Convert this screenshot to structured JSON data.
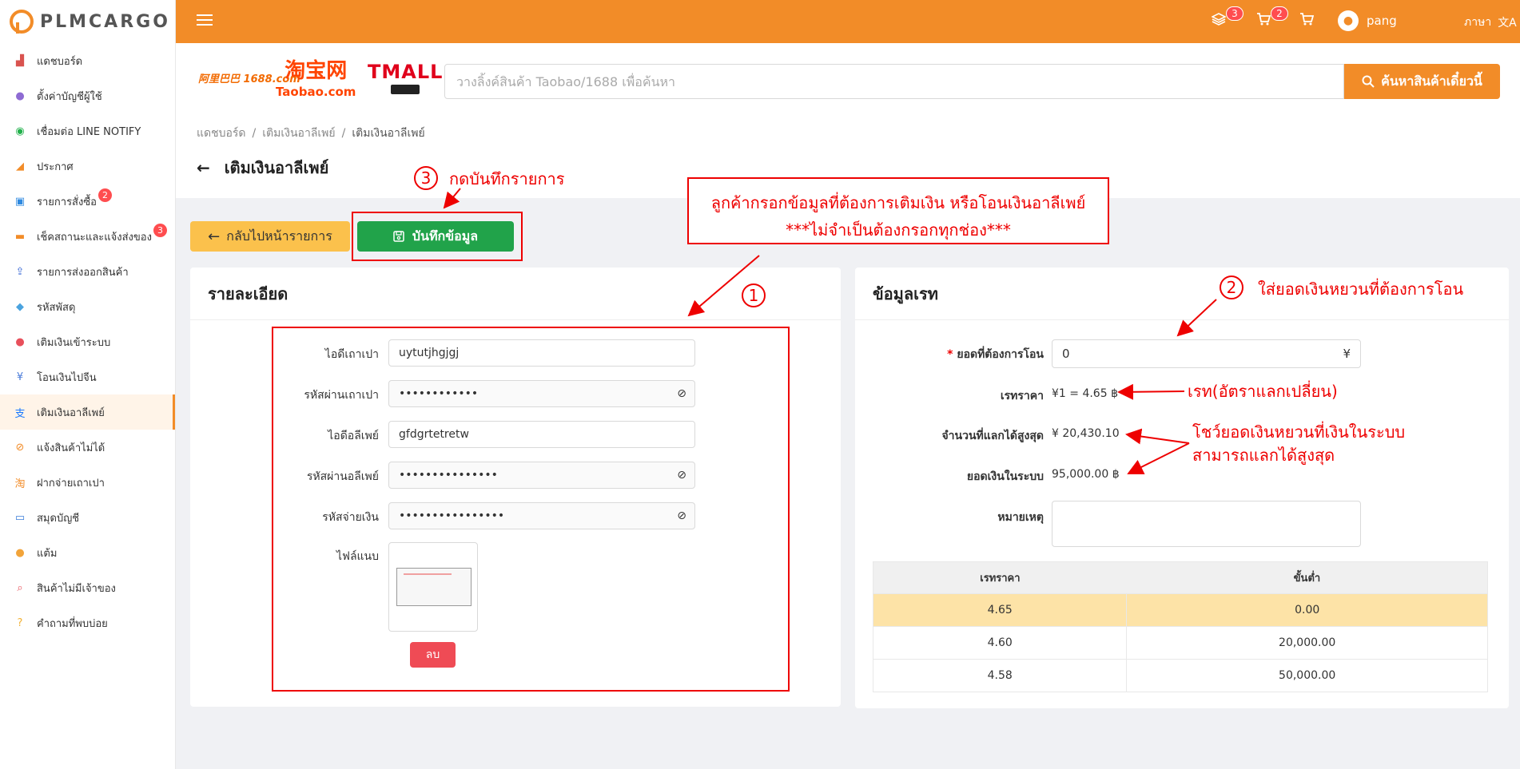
{
  "app": {
    "logo_text": "PLMCARGO"
  },
  "sidebar": {
    "items": [
      {
        "label": "แดชบอร์ด",
        "icon": "chart-icon"
      },
      {
        "label": "ตั้งค่าบัญชีผู้ใช้",
        "icon": "user-settings-icon"
      },
      {
        "label": "เชื่อมต่อ LINE NOTIFY",
        "icon": "line-icon"
      },
      {
        "label": "ประกาศ",
        "icon": "megaphone-icon"
      },
      {
        "label": "รายการสั่งซื้อ",
        "icon": "cart-icon",
        "badge": "2"
      },
      {
        "label": "เช็คสถานะและแจ้งส่งของ",
        "icon": "truck-icon",
        "badge": "3"
      },
      {
        "label": "รายการส่งออกสินค้า",
        "icon": "export-icon"
      },
      {
        "label": "รหัสพัสดุ",
        "icon": "box-icon"
      },
      {
        "label": "เติมเงินเข้าระบบ",
        "icon": "piggy-bank-icon"
      },
      {
        "label": "โอนเงินไปจีน",
        "icon": "yuan-icon"
      },
      {
        "label": "เติมเงินอาลีเพย์",
        "icon": "alipay-icon",
        "active": true
      },
      {
        "label": "แจ้งสินค้าไม่ได้",
        "icon": "no-item-icon"
      },
      {
        "label": "ฝากจ่ายเถาเปา",
        "icon": "taobao-pay-icon"
      },
      {
        "label": "สมุดบัญชี",
        "icon": "wallet-icon"
      },
      {
        "label": "แต้ม",
        "icon": "coin-icon"
      },
      {
        "label": "สินค้าไม่มีเจ้าของ",
        "icon": "search-box-icon"
      },
      {
        "label": "คำถามที่พบบ่อย",
        "icon": "question-icon"
      }
    ]
  },
  "topbar": {
    "badge_layers": "3",
    "badge_cart": "2",
    "username": "pang",
    "language": "ภาษา"
  },
  "search": {
    "brand_1688": "阿里巴巴 1688.com",
    "brand_taobao": "淘宝网",
    "brand_taobao_sub": "Taobao.com",
    "brand_tmall": "TMALL",
    "placeholder": "วางลิ้งค์สินค้า Taobao/1688 เพื่อค้นหา",
    "button": "ค้นหาสินค้าเดี๋ยวนี้"
  },
  "breadcrumb": [
    "แดชบอร์ด",
    "เติมเงินอาลีเพย์",
    "เติมเงินอาลีเพย์"
  ],
  "page_title": "เติมเงินอาลีเพย์",
  "buttons": {
    "back": "กลับไปหน้ารายการ",
    "save": "บันทึกข้อมูล",
    "delete": "ลบ"
  },
  "detail": {
    "title": "รายละเอียด",
    "fields": [
      {
        "label": "ไอดีเถาเปา",
        "value": "uytutjhgjgj"
      },
      {
        "label": "รหัสผ่านเถาเปา",
        "value": "••••••••••••"
      },
      {
        "label": "ไอดีอลีเพย์",
        "value": "gfdgrtetretw"
      },
      {
        "label": "รหัสผ่านอลีเพย์",
        "value": "•••••••••••••••"
      },
      {
        "label": "รหัสจ่ายเงิน",
        "value": "••••••••••••••••"
      }
    ],
    "attachment_label": "ไฟล์แนบ"
  },
  "rate": {
    "title": "ข้อมูลเรท",
    "amount_label": "ยอดที่ต้องการโอน",
    "amount_value": "0",
    "amount_suffix": "¥",
    "rate_label": "เรทราคา",
    "rate_value": "¥1 = 4.65 ฿",
    "max_label": "จำนวนที่แลกได้สูงสุด",
    "max_value": "¥ 20,430.10",
    "balance_label": "ยอดเงินในระบบ",
    "balance_value": "95,000.00 ฿",
    "note_label": "หมายเหตุ",
    "table_headers": [
      "เรทราคา",
      "ขั้นต่ำ"
    ],
    "table_rows": [
      [
        "4.65",
        "0.00"
      ],
      [
        "4.60",
        "20,000.00"
      ],
      [
        "4.58",
        "50,000.00"
      ]
    ]
  },
  "annotations": {
    "n1": "1",
    "n2": "2",
    "n3": "3",
    "step3": "กดบันทึกรายการ",
    "box_line1": "ลูกค้ากรอกข้อมูลที่ต้องการเติมเงิน หรือโอนเงินอาลีเพย์",
    "box_line2": "***ไม่จำเป็นต้องกรอกทุกช่อง***",
    "step2": "ใส่ยอดเงินหยวนที่ต้องการโอน",
    "rate_note": "เรท(อัตราแลกเปลี่ยน)",
    "max_note_1": "โชว์ยอดเงินหยวนที่เงินในระบบ",
    "max_note_2": "สามารถแลกได้สูงสุด"
  },
  "colors": {
    "brand_orange": "#f28c28",
    "save_green": "#21a34a",
    "back_yellow": "#fbc14c",
    "annotation_red": "#e00000"
  }
}
